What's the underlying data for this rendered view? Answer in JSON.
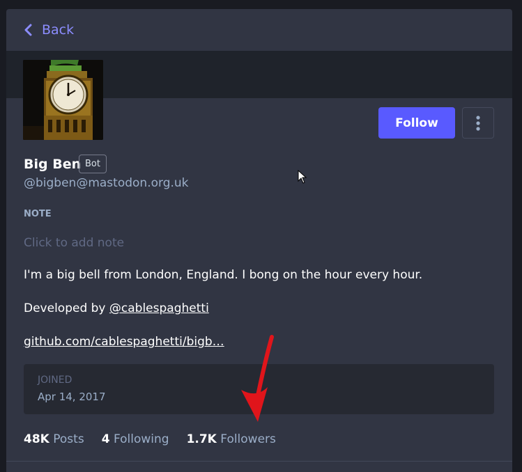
{
  "back": {
    "label": "Back"
  },
  "profile": {
    "display_name": "Big Ben",
    "bot_badge": "Bot",
    "handle": "@bigben@mastodon.org.uk",
    "avatar": "big-ben-clock-tower-avatar"
  },
  "actions": {
    "follow_label": "Follow",
    "more_icon": "vertical-ellipsis-icon"
  },
  "note": {
    "label": "NOTE",
    "placeholder": "Click to add note"
  },
  "bio": {
    "line1": "I'm a big bell from London, England. I bong on the hour every hour.",
    "line2_prefix": "Developed by ",
    "line2_link": "@cablespaghetti",
    "line3_link": "github.com/cablespaghetti/bigb…"
  },
  "joined": {
    "label": "JOINED",
    "date": "Apr 14, 2017"
  },
  "stats": {
    "posts_count": "48K",
    "posts_label": "Posts",
    "following_count": "4",
    "following_label": "Following",
    "followers_count": "1.7K",
    "followers_label": "Followers"
  },
  "colors": {
    "background": "#191b22",
    "panel": "#313543",
    "accent": "#595aff",
    "link": "#8c8dff",
    "muted": "#9baec8",
    "annotation_arrow": "#e0151b"
  }
}
